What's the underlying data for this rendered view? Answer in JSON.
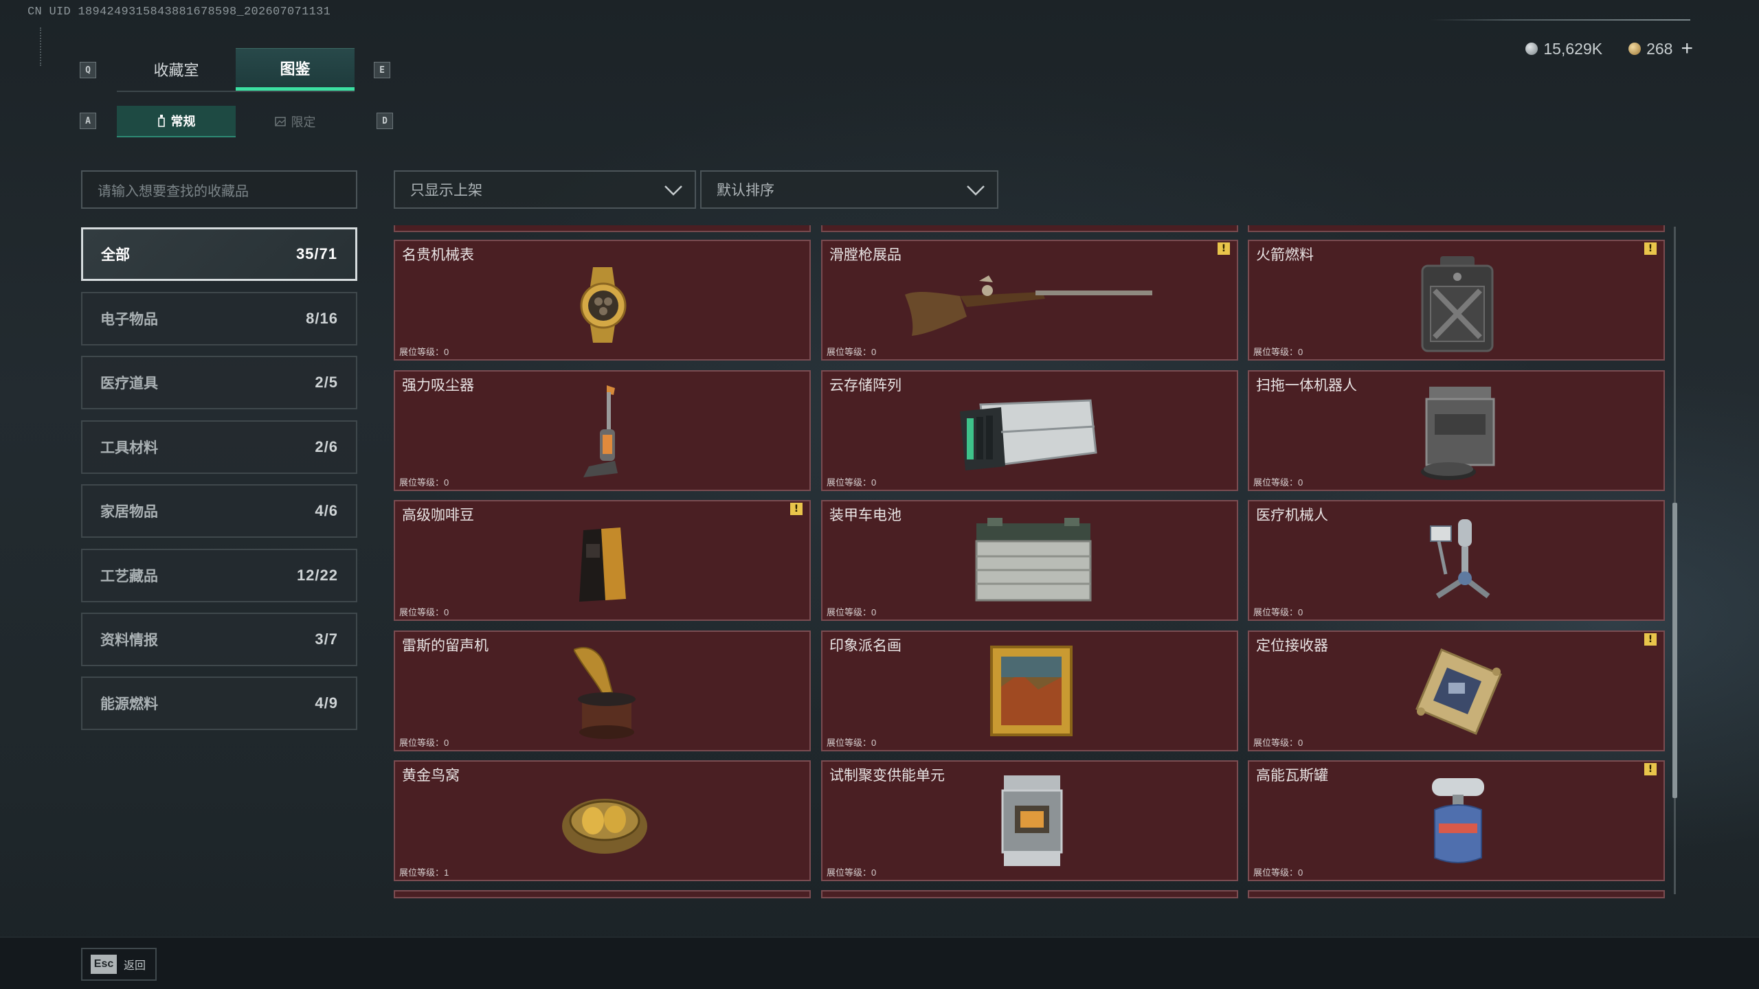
{
  "uid_text": "CN UID 1894249315843881678598_202607071131",
  "hotkeys": {
    "prev_tab": "Q",
    "next_tab": "E",
    "prev_sub": "A",
    "next_sub": "D"
  },
  "main_tabs": [
    {
      "label": "收藏室",
      "active": false
    },
    {
      "label": "图鉴",
      "active": true
    }
  ],
  "sub_tabs": [
    {
      "label": "常规",
      "active": true
    },
    {
      "label": "限定",
      "active": false
    }
  ],
  "currency": {
    "silver": {
      "icon": "silver-coin-icon",
      "value": "15,629K"
    },
    "gold": {
      "icon": "gold-coin-icon",
      "value": "268"
    },
    "add": "+"
  },
  "search": {
    "placeholder": "请输入想要查找的收藏品"
  },
  "filters": {
    "display": "只显示上架",
    "sort": "默认排序"
  },
  "categories": [
    {
      "label": "全部",
      "count": "35/71",
      "active": true
    },
    {
      "label": "电子物品",
      "count": "8/16"
    },
    {
      "label": "医疗道具",
      "count": "2/5"
    },
    {
      "label": "工具材料",
      "count": "2/6"
    },
    {
      "label": "家居物品",
      "count": "4/6"
    },
    {
      "label": "工艺藏品",
      "count": "12/22"
    },
    {
      "label": "资料情报",
      "count": "3/7"
    },
    {
      "label": "能源燃料",
      "count": "4/9"
    }
  ],
  "items": [
    {
      "name": "名贵机械表",
      "level": "展位等级：0",
      "warning": false,
      "icon": "luxury-watch-icon"
    },
    {
      "name": "滑膛枪展品",
      "level": "展位等级：0",
      "warning": true,
      "icon": "musket-icon"
    },
    {
      "name": "火箭燃料",
      "level": "展位等级：0",
      "warning": true,
      "icon": "fuel-canister-icon"
    },
    {
      "name": "强力吸尘器",
      "level": "展位等级：0",
      "warning": false,
      "icon": "vacuum-cleaner-icon"
    },
    {
      "name": "云存储阵列",
      "level": "展位等级：0",
      "warning": false,
      "icon": "storage-array-icon"
    },
    {
      "name": "扫拖一体机器人",
      "level": "展位等级：0",
      "warning": false,
      "icon": "mop-robot-icon"
    },
    {
      "name": "高级咖啡豆",
      "level": "展位等级：0",
      "warning": true,
      "icon": "coffee-bag-icon"
    },
    {
      "name": "装甲车电池",
      "level": "展位等级：0",
      "warning": false,
      "icon": "vehicle-battery-icon"
    },
    {
      "name": "医疗机械人",
      "level": "展位等级：0",
      "warning": false,
      "icon": "medical-robot-icon"
    },
    {
      "name": "雷斯的留声机",
      "level": "展位等级：0",
      "warning": false,
      "icon": "gramophone-icon"
    },
    {
      "name": "印象派名画",
      "level": "展位等级：0",
      "warning": false,
      "icon": "framed-painting-icon"
    },
    {
      "name": "定位接收器",
      "level": "展位等级：0",
      "warning": true,
      "icon": "gps-receiver-icon"
    },
    {
      "name": "黄金鸟窝",
      "level": "展位等级：1",
      "warning": false,
      "icon": "golden-nest-icon"
    },
    {
      "name": "试制聚变供能单元",
      "level": "展位等级：0",
      "warning": false,
      "icon": "fusion-unit-icon"
    },
    {
      "name": "高能瓦斯罐",
      "level": "展位等级：0",
      "warning": true,
      "icon": "gas-canister-icon"
    }
  ],
  "warning_glyph": "!",
  "footer": {
    "esc_key": "Esc",
    "esc_label": "返回"
  },
  "colors": {
    "accent": "#3ce0a2",
    "card_bg": "#4a1f23",
    "card_border": "#7a4c51",
    "warning": "#e9c54b"
  }
}
